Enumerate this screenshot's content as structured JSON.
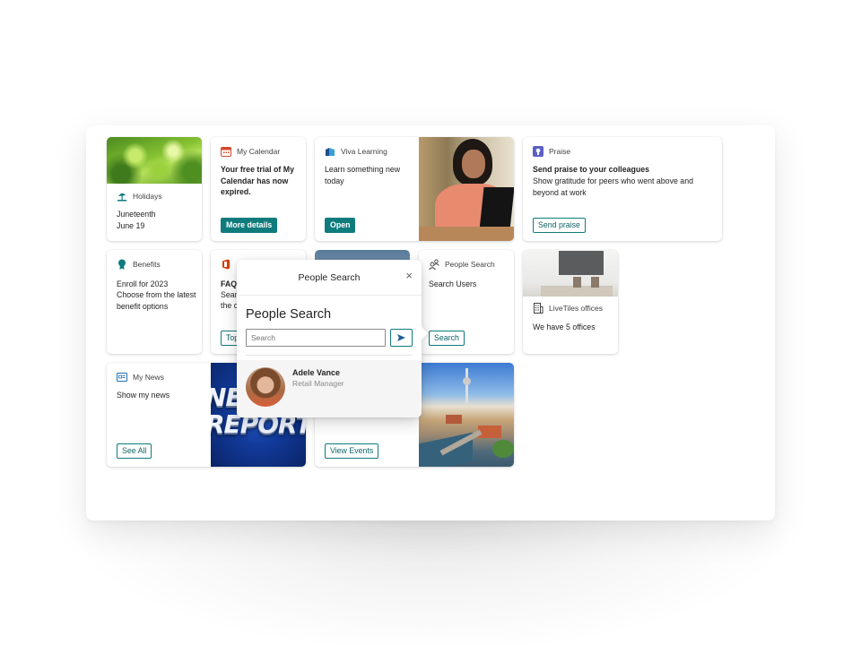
{
  "cards": {
    "holidays": {
      "label": "Holidays",
      "title": "Juneteenth",
      "text": "June 19"
    },
    "calendar": {
      "label": "My Calendar",
      "title": "Your free trial of My Calendar has now expired.",
      "button": "More details"
    },
    "viva": {
      "label": "Viva Learning",
      "title": "Learn something new today",
      "button": "Open"
    },
    "praise": {
      "label": "Praise",
      "title": "Send praise to your colleagues",
      "text": "Show gratitude for peers who went above and beyond at work",
      "button": "Send praise"
    },
    "benefits": {
      "label": "Benefits",
      "title": "Enroll for 2023",
      "text": "Choose from the latest benefit options"
    },
    "faqs": {
      "title": "FAQs",
      "text": "Sear",
      "text2": "the c",
      "button": "Top"
    },
    "people_search": {
      "label": "People Search",
      "title": "Search Users",
      "button": "Search"
    },
    "offices": {
      "label": "LiveTiles offices",
      "title": "We have 5 offices"
    },
    "news": {
      "label": "My News",
      "title": "Show my news",
      "button": "See All",
      "image_text_1": "NE",
      "image_text_2": "REPORT"
    },
    "events": {
      "button": "View Events"
    }
  },
  "popup": {
    "header_title": "People Search",
    "close_icon": "×",
    "heading": "People Search",
    "search_placeholder": "Search",
    "send_icon": "send-icon",
    "result": {
      "name": "Adele Vance",
      "role": "Retail Manager"
    }
  },
  "colors": {
    "accent": "#0f7b7d",
    "calendar_icon": "#d9472b",
    "praise_icon": "#5b5fc7",
    "benefits_icon": "#0f7b7d",
    "office_icon": "#d83b01"
  }
}
